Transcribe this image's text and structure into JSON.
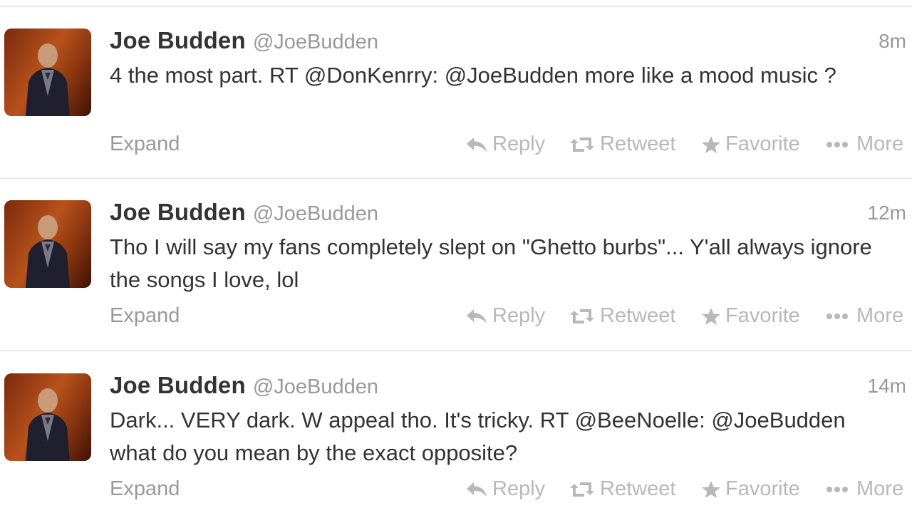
{
  "tweets": [
    {
      "fullname": "Joe Budden",
      "username": "@JoeBudden",
      "time": "8m",
      "text_parts": [
        "4 the most part. RT ",
        "@DonKenrry",
        ": ",
        "@JoeBudden",
        " more like a mood music ?"
      ],
      "expand": "Expand",
      "actions": {
        "reply": "Reply",
        "retweet": "Retweet",
        "favorite": "Favorite",
        "more": "More"
      }
    },
    {
      "fullname": "Joe Budden",
      "username": "@JoeBudden",
      "time": "12m",
      "text_parts": [
        "Tho I will say my fans completely slept on \"Ghetto burbs\"... Y'all always ignore the songs I love, lol"
      ],
      "expand": "Expand",
      "actions": {
        "reply": "Reply",
        "retweet": "Retweet",
        "favorite": "Favorite",
        "more": "More"
      }
    },
    {
      "fullname": "Joe Budden",
      "username": "@JoeBudden",
      "time": "14m",
      "text_parts": [
        "Dark... VERY dark. W appeal tho. It's tricky. RT ",
        "@BeeNoelle",
        ": ",
        "@JoeBudden",
        " what do you mean by the exact opposite?"
      ],
      "expand": "Expand",
      "actions": {
        "reply": "Reply",
        "retweet": "Retweet",
        "favorite": "Favorite",
        "more": "More"
      }
    }
  ],
  "icons": {
    "reply": "reply-arrow-icon",
    "retweet": "retweet-icon",
    "favorite": "star-icon",
    "more": "ellipsis-icon"
  },
  "colors": {
    "text": "#333333",
    "muted": "#999999",
    "action": "#b8b8b8",
    "divider": "#e8e8e8"
  }
}
